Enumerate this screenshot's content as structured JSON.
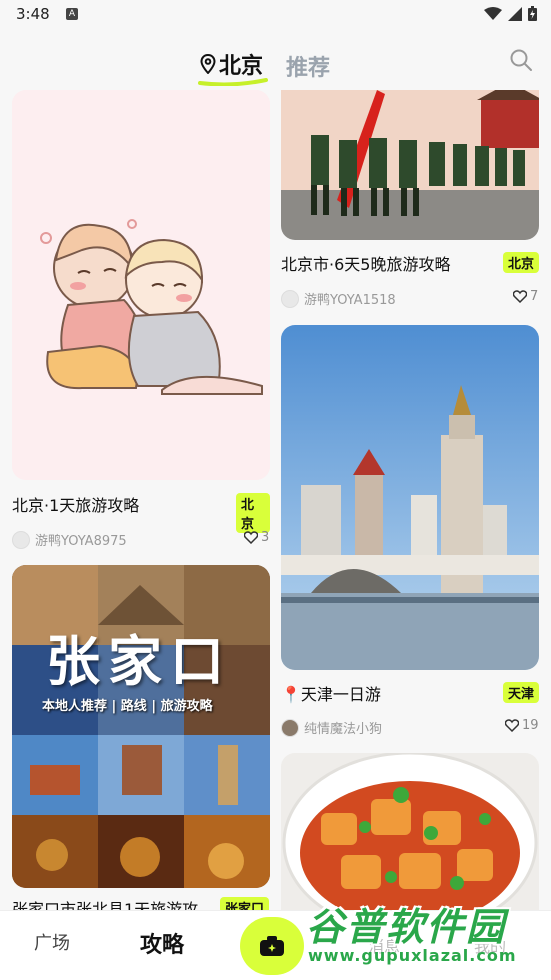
{
  "status_bar": {
    "time": "3:48",
    "notification_glyph": "A"
  },
  "header": {
    "tab_location": "北京",
    "tab_recommend": "推荐",
    "accent": "#d9ff3a"
  },
  "feed": {
    "left": [
      {
        "title": "北京·1天旅游攻略",
        "badge": "北京",
        "author": "游鸭YOYA8975",
        "likes": "3"
      },
      {
        "title": "张家口市张北县1天旅游攻",
        "badge": "张家口",
        "image_text": "张家口",
        "image_subtext": "本地人推荐 | 路线 | 旅游攻略"
      }
    ],
    "right": [
      {
        "title": "北京市·6天5晚旅游攻略",
        "badge": "北京",
        "author": "游鸭YOYA1518",
        "likes": "7"
      },
      {
        "title": "📍天津一日游",
        "badge": "天津",
        "author": "纯情魔法小狗",
        "likes": "19"
      },
      {
        "title": "",
        "badge": ""
      }
    ]
  },
  "bottom_nav": {
    "tab_square": "广场",
    "tab_guide": "攻略",
    "tab_message": "消息",
    "tab_me": "我的"
  },
  "watermark": {
    "brand": "谷普软件园",
    "url": "www.gupuxlazal.com"
  }
}
